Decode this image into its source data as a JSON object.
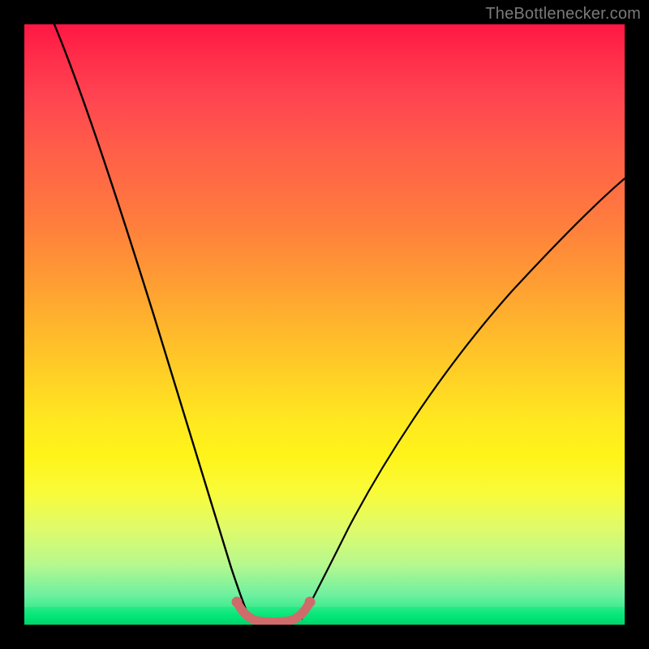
{
  "watermark": {
    "text": "TheBottlenecker.com"
  },
  "colors": {
    "background": "#000000",
    "gradient_top": "#ff1744",
    "gradient_mid": "#ffe820",
    "gradient_bottom": "#00e676",
    "curve_stroke": "#000000",
    "highlight_stroke": "#cf6b6b"
  },
  "chart_data": {
    "type": "line",
    "title": "",
    "xlabel": "",
    "ylabel": "",
    "xlim": [
      0,
      100
    ],
    "ylim": [
      0,
      100
    ],
    "series": [
      {
        "name": "left-curve",
        "x": [
          5,
          8,
          11,
          14,
          17,
          20,
          23,
          26,
          28,
          30,
          32,
          34,
          35.5,
          37
        ],
        "y": [
          100,
          92,
          83,
          74,
          65,
          56,
          46,
          36,
          28,
          21,
          14,
          8,
          4,
          1
        ]
      },
      {
        "name": "right-curve",
        "x": [
          46,
          48,
          50,
          53,
          57,
          62,
          68,
          75,
          83,
          91,
          100
        ],
        "y": [
          1,
          3,
          6,
          10,
          16,
          23,
          31,
          40,
          49,
          58,
          67
        ]
      },
      {
        "name": "bottom-highlight",
        "x": [
          35.5,
          37,
          39,
          41,
          43,
          45,
          46.5
        ],
        "y": [
          3,
          1,
          0.5,
          0.5,
          0.5,
          1,
          3
        ]
      }
    ],
    "annotations": [
      {
        "text": "TheBottlenecker.com",
        "position": "top-right"
      }
    ]
  }
}
